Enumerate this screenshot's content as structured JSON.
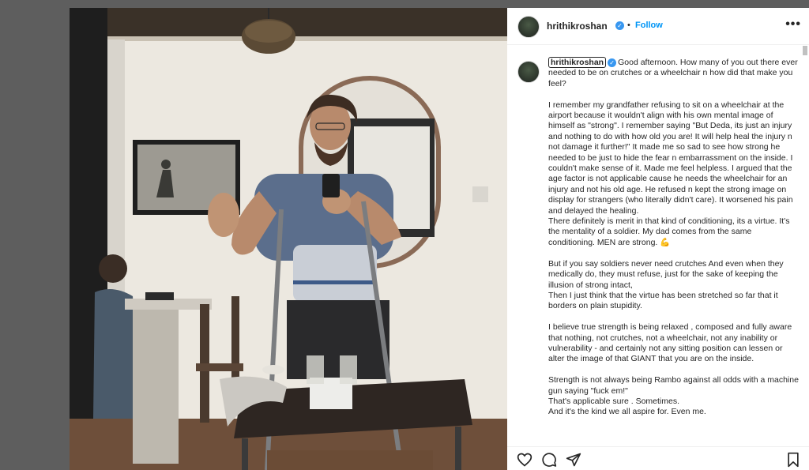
{
  "header": {
    "username": "hrithikroshan",
    "separator": "•",
    "follow_label": "Follow",
    "more_label": "•••"
  },
  "caption": {
    "username": "hrithikroshan",
    "paragraphs": [
      "Good afternoon. How many of you out there ever needed to be on crutches or a wheelchair n how did that make you feel?",
      "I remember my grandfather refusing to sit on a wheelchair at the airport because it wouldn't align with his own mental image of himself as \"strong\". I remember saying \"But Deda, its just an injury and nothing to do with how old you are! It will help heal the injury n not damage it further!\" It made me so sad to see how strong he needed to be just to hide the fear n embarrassment on the inside. I couldn't make sense of it. Made me feel helpless. I argued that the age factor is not applicable cause he needs the wheelchair for an injury and not his old age. He refused n kept the strong image on display for strangers (who literally didn't care). It worsened his pain and delayed the healing.\nThere definitely is merit in that kind of conditioning, its a virtue. It's the mentality of a soldier. My dad comes from the same conditioning. MEN are strong. 💪",
      "But if you say soldiers never need crutches And even when they medically do, they must refuse, just for the sake of keeping the illusion of strong intact,\nThen I just think that the virtue has been stretched so far that it borders on plain stupidity.",
      "I believe true strength is being relaxed , composed and fully aware that nothing, not crutches, not a wheelchair, not any inability or vulnerability - and certainly not any sitting position can lessen or alter the image of that GIANT that you are on the inside.",
      "Strength is not always being Rambo against all odds with a machine gun saying \"fuck em!\"\nThat's applicable sure . Sometimes.\nAnd it's the kind we all aspire for. Even me."
    ]
  },
  "actions": {
    "icons": [
      "heart-icon",
      "comment-icon",
      "share-icon",
      "bookmark-icon"
    ]
  },
  "colors": {
    "accent": "#0095f6",
    "verified": "#3897f0",
    "text": "#262626"
  }
}
